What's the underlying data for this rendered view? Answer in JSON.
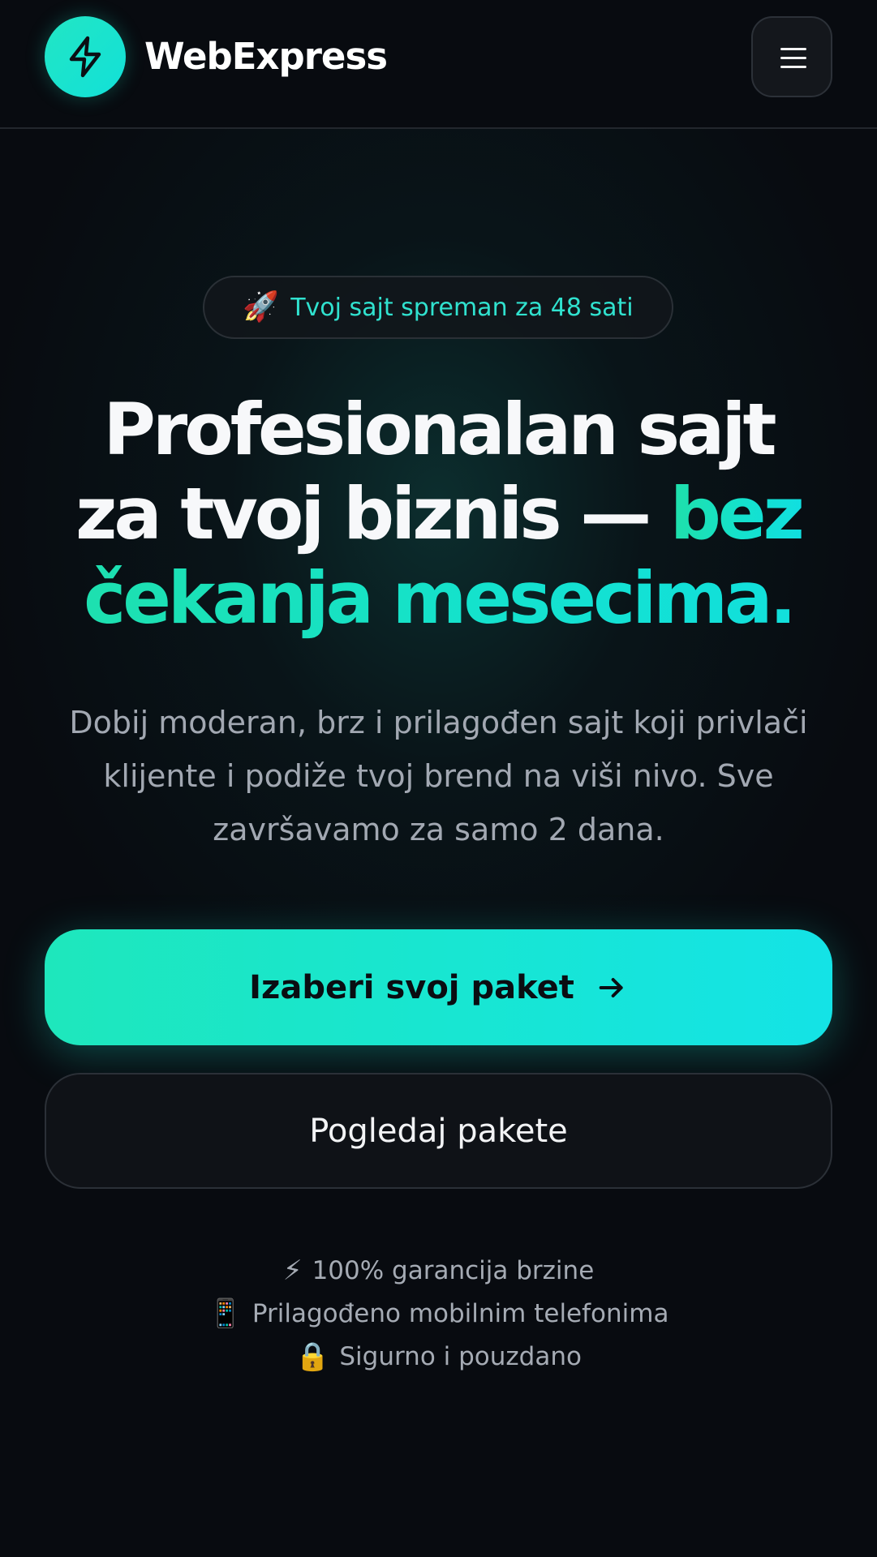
{
  "header": {
    "brand_name": "WebExpress",
    "logo_icon": "lightning-bolt-icon",
    "menu_icon": "hamburger-menu-icon"
  },
  "hero": {
    "pill": {
      "icon": "🚀",
      "text": "Tvoj sajt spreman za 48 sati"
    },
    "headline": {
      "line1": "Profesionalan sajt",
      "line2_white": "za tvoj biznis — ",
      "line2_accent": "bez",
      "line3_accent": "čekanja mesecima."
    },
    "description": {
      "line1": "Dobij moderan, brz i prilagođen sajt koji privlači",
      "line2": "klijente i podiže tvoj brend na viši nivo. Sve",
      "line3": "završavamo za samo 2 dana."
    },
    "primary_button_label": "Izaberi svoj paket",
    "secondary_button_label": "Pogledaj pakete"
  },
  "features": [
    {
      "icon": "⚡",
      "text": "100% garancija brzine"
    },
    {
      "icon": "📱",
      "text": "Prilagođeno mobilnim telefonima"
    },
    {
      "icon": "🔒",
      "text": "Sigurno i pouzdano"
    }
  ],
  "colors": {
    "background": "#080b10",
    "accent": "#18e6d1",
    "accent_green": "#1fe0a9",
    "muted_text": "#a2a8b2"
  }
}
